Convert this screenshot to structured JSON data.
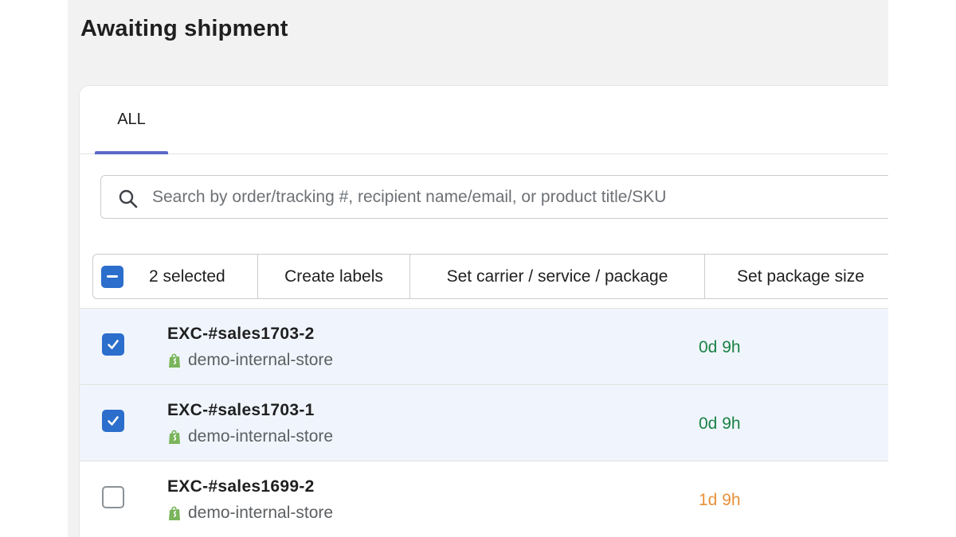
{
  "page": {
    "title": "Awaiting shipment"
  },
  "tabs": [
    {
      "label": "ALL",
      "active": true
    }
  ],
  "search": {
    "placeholder": "Search by order/tracking #, recipient name/email, or product title/SKU",
    "value": ""
  },
  "bulk_actions": {
    "selected_label": "2 selected",
    "create_labels": "Create labels",
    "set_carrier": "Set carrier / service / package",
    "set_package_size": "Set package size"
  },
  "orders": [
    {
      "id": "EXC-#sales1703-2",
      "store": "demo-internal-store",
      "age": "0d 9h",
      "age_color": "#1a8245",
      "checked": true
    },
    {
      "id": "EXC-#sales1703-1",
      "store": "demo-internal-store",
      "age": "0d 9h",
      "age_color": "#1a8245",
      "checked": true
    },
    {
      "id": "EXC-#sales1699-2",
      "store": "demo-internal-store",
      "age": "1d 9h",
      "age_color": "#e8903a",
      "checked": false
    }
  ],
  "colors": {
    "accent": "#2c6ecb",
    "tab_indicator": "#5b6ac6",
    "selected_row": "#f0f5fd",
    "store_icon": "#7ab55c"
  },
  "icons": {
    "search": "search-icon",
    "store": "shopify-bag-icon",
    "checkbox_checked": "checkmark-icon",
    "checkbox_indeterminate": "minus-icon"
  }
}
